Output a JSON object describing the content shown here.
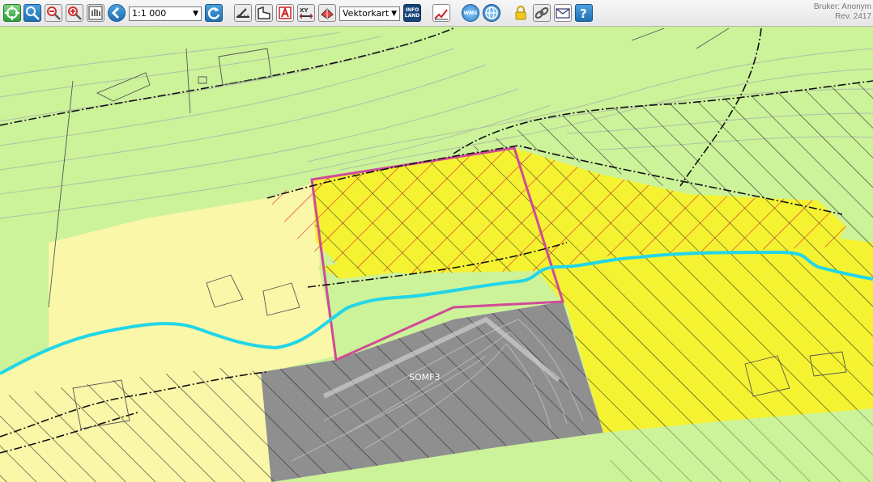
{
  "toolbar": {
    "scale_value": "1:1 000",
    "layer_value": "Vektorkart",
    "infoland_label": "INFO LAND",
    "wms_label": "WMS",
    "user_line": "Bruker: Anonym",
    "rev_line": "Rev. 2417",
    "icons": [
      "zoom-extent-icon",
      "zoom-window-icon",
      "zoom-out-icon",
      "zoom-in-icon",
      "pan-icon",
      "back-icon",
      "refresh-icon",
      "measure-icon",
      "area-icon",
      "text-icon",
      "coordinate-icon",
      "print-icon",
      "infoland-icon",
      "profile-icon",
      "wms-icon",
      "globe-icon",
      "lock-icon",
      "link-icon",
      "mail-icon",
      "help-icon"
    ]
  },
  "map": {
    "plot_label": "SOMF3",
    "colors": {
      "light_green": "#ccf29a",
      "pale_yellow": "#fbf7a8",
      "yellow": "#f5f331",
      "grey": "#8f8f8f",
      "river": "#22d6e8",
      "boundary": "#d04a98",
      "hazard_hatch": "#e23030"
    }
  }
}
